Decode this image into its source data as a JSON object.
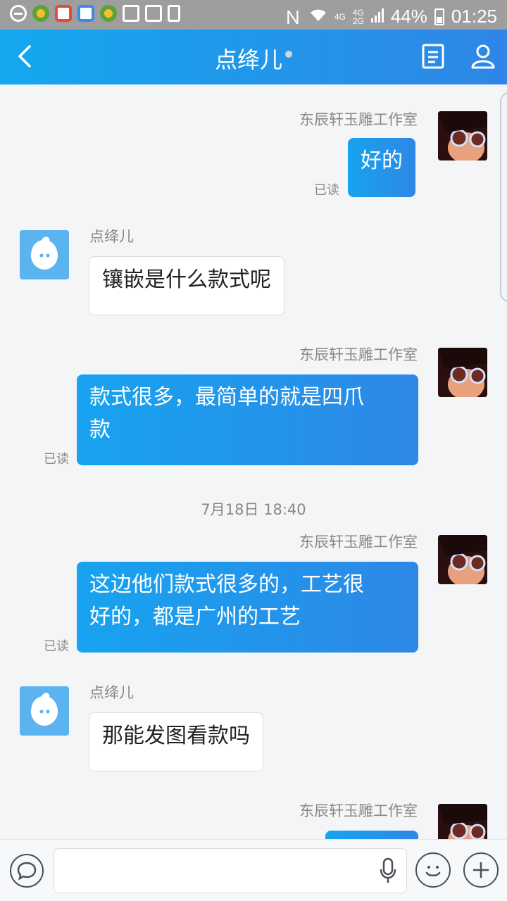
{
  "status_bar": {
    "signal_4g": "4G",
    "signal_4g_2g_top": "4G",
    "signal_4g_2g_bottom": "2G",
    "battery": "44%",
    "time": "01:25"
  },
  "header": {
    "title": "点绛儿"
  },
  "messages": [
    {
      "sender": "东辰轩玉雕工作室",
      "text": "好的",
      "read": "已读"
    },
    {
      "sender": "点绛儿",
      "text": "镶嵌是什么款式呢"
    },
    {
      "sender": "东辰轩玉雕工作室",
      "text_line1": "款式很多，最简单的就是四爪",
      "text_line2": "款",
      "read": "已读"
    },
    {
      "timestamp": "7月18日 18:40"
    },
    {
      "sender": "东辰轩玉雕工作室",
      "text_line1": "这边他们款式很多的，工艺很",
      "text_line2": "好的，都是广州的工艺",
      "read": "已读"
    },
    {
      "sender": "点绛儿",
      "text": "那能发图看款吗"
    },
    {
      "sender": "东辰轩玉雕工作室"
    }
  ]
}
